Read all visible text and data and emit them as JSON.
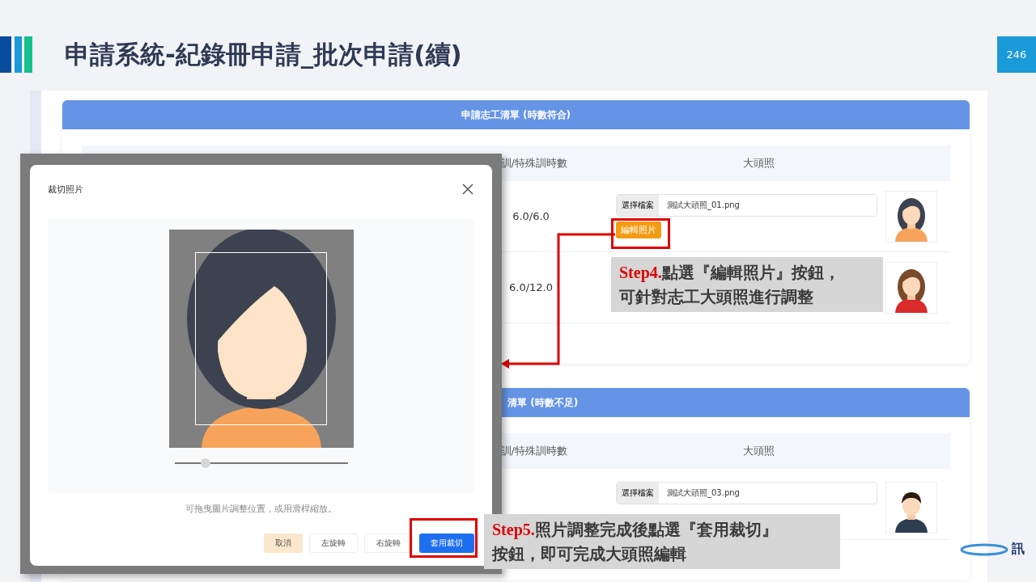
{
  "slide": {
    "title": "申請系統-紀錄冊申請_批次申請(續)",
    "page_number": "246",
    "logo_text": "訊"
  },
  "sections": [
    {
      "header": "申請志工清單 (時數符合)",
      "columns": [
        "訓/特殊訓時數",
        "大頭照"
      ],
      "rows": [
        {
          "hours": "6.0/6.0",
          "file_button": "選擇檔案",
          "file_name": "測試大頭照_01.png",
          "edit_button": "編輯照片",
          "avatar": {
            "kind": "woman"
          }
        },
        {
          "hours": "6.0/12.0",
          "avatar": {
            "kind": "girl"
          }
        }
      ]
    },
    {
      "header": "清單 (時數不足)",
      "columns": [
        "訓/特殊訓時數",
        "大頭照"
      ],
      "rows": [
        {
          "file_button": "選擇檔案",
          "file_name": "測試大頭照_03.png",
          "avatar": {
            "kind": "man"
          }
        }
      ]
    }
  ],
  "dialog": {
    "title": "裁切照片",
    "zoom": {
      "level": 0.18
    },
    "hint": "可拖曳圖片調整位置，或用滑桿縮放。",
    "buttons": [
      {
        "label": "取消",
        "kind": "cancel"
      },
      {
        "label": "左旋轉",
        "kind": "plain"
      },
      {
        "label": "右旋轉",
        "kind": "plain"
      },
      {
        "label": "套用裁切",
        "kind": "primary"
      }
    ]
  },
  "callouts": [
    {
      "step": "Step4.",
      "text": "點選『編輯照片』按鈕，可針對志工大頭照進行調整"
    },
    {
      "step": "Step5.",
      "text": "照片調整完成後點選『套用裁切』按鈕，即可完成大頭照編輯"
    }
  ]
}
